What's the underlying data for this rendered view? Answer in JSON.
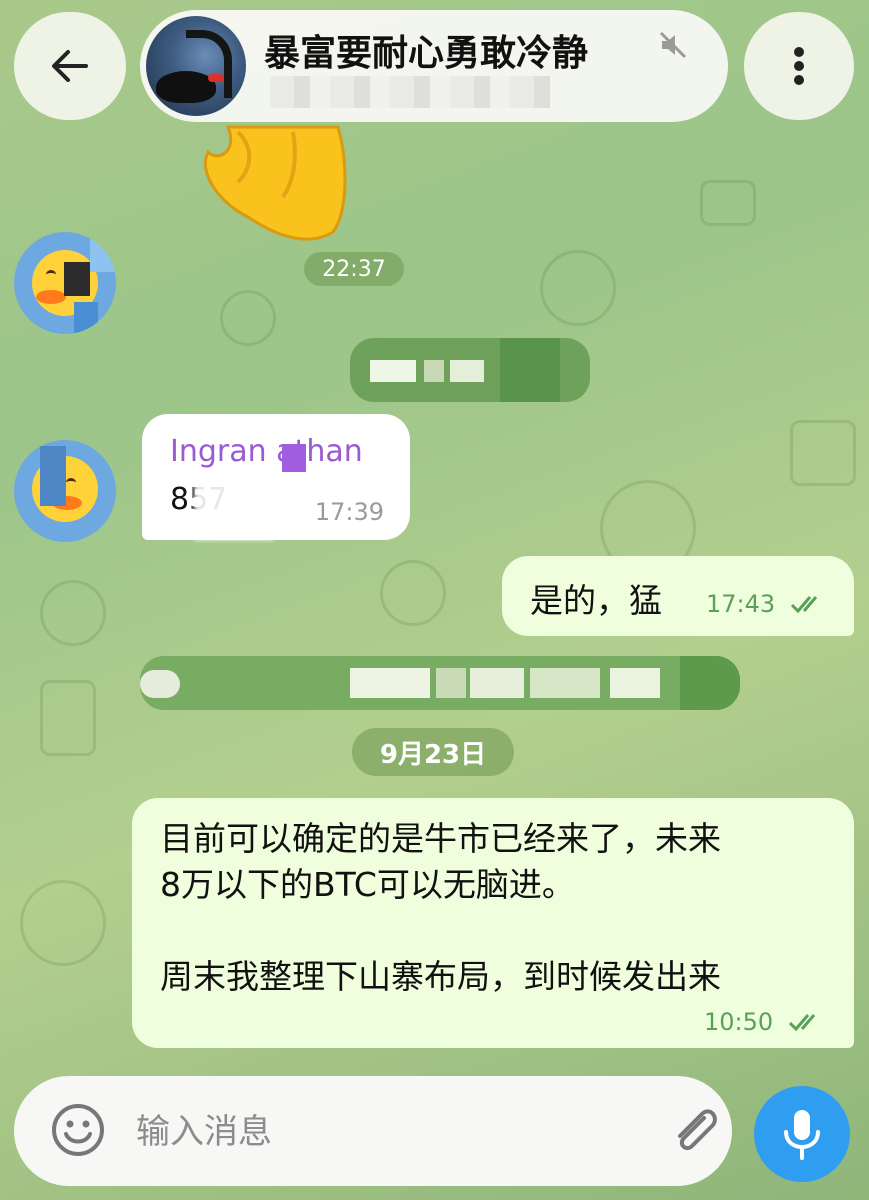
{
  "header": {
    "group_title": "暴富要耐心勇敢冷静",
    "muted_icon": "muted-speaker-icon",
    "back_icon": "arrow-left-icon",
    "menu_icon": "more-vertical-icon"
  },
  "chat": {
    "sticker_time": "22:37",
    "incoming": {
      "sender": "Ingran athan",
      "text": "857",
      "time": "17:39"
    },
    "outgoing_short": {
      "text": "是的，猛",
      "time": "17:43",
      "status": "read"
    },
    "date_separator": "9月23日",
    "outgoing_long": {
      "line1": "目前可以确定的是牛市已经来了，未来",
      "line2": "8万以下的BTC可以无脑进。",
      "line3": "周末我整理下山寨布局，到时候发出来",
      "time": "10:50",
      "status": "read"
    }
  },
  "composer": {
    "placeholder": "输入消息",
    "emoji_icon": "smiley-icon",
    "attach_icon": "paperclip-icon",
    "mic_icon": "microphone-icon"
  },
  "colors": {
    "accent": "#2f9ef0",
    "outgoing_bubble": "#effedd",
    "sender_name": "#9a5bd0",
    "read_ticks": "#5aa05a"
  }
}
